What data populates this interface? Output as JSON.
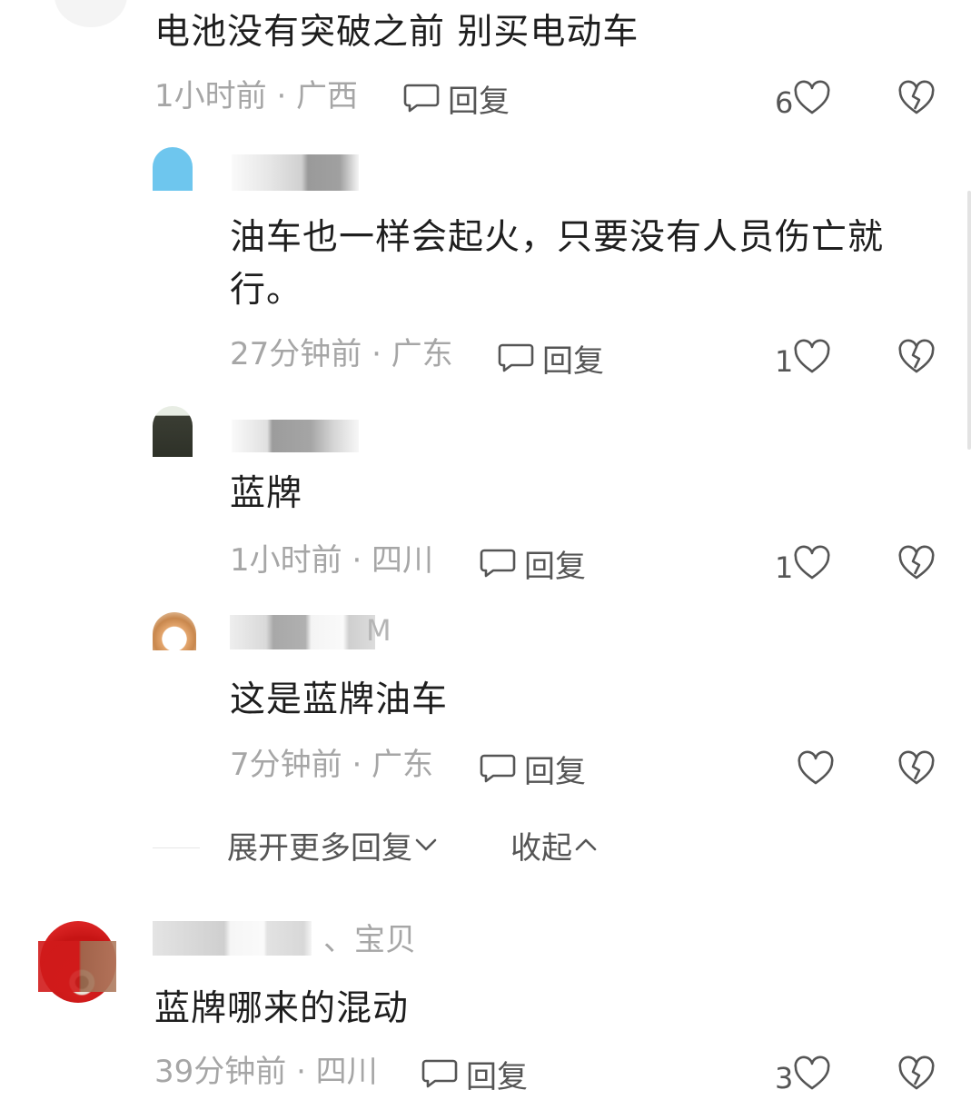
{
  "comments": [
    {
      "text": "电池没有突破之前 别买电动车",
      "meta": "1小时前 · 广西",
      "reply_label": "回复",
      "likes": "6"
    },
    {
      "username_fragment": "",
      "text_line1": "油车也一样会起火，只要没有人员伤亡就",
      "text_line2": "行。",
      "meta": "27分钟前 · 广东",
      "reply_label": "回复",
      "likes": "1"
    },
    {
      "username_fragment": "",
      "text": "蓝牌",
      "meta": "1小时前 · 四川",
      "reply_label": "回复",
      "likes": "1"
    },
    {
      "username_fragment": "M",
      "text": "这是蓝牌油车",
      "meta": "7分钟前 · 广东",
      "reply_label": "回复",
      "likes": ""
    },
    {
      "username_suffix": "、宝贝",
      "text": "蓝牌哪来的混动",
      "meta": "39分钟前 · 四川",
      "reply_label": "回复",
      "likes": "3"
    }
  ],
  "expand_more": "展开更多回复",
  "collapse": "收起",
  "colors": {
    "meta": "#a6a6a6",
    "text": "#1e1e1e",
    "icon": "#555555"
  }
}
